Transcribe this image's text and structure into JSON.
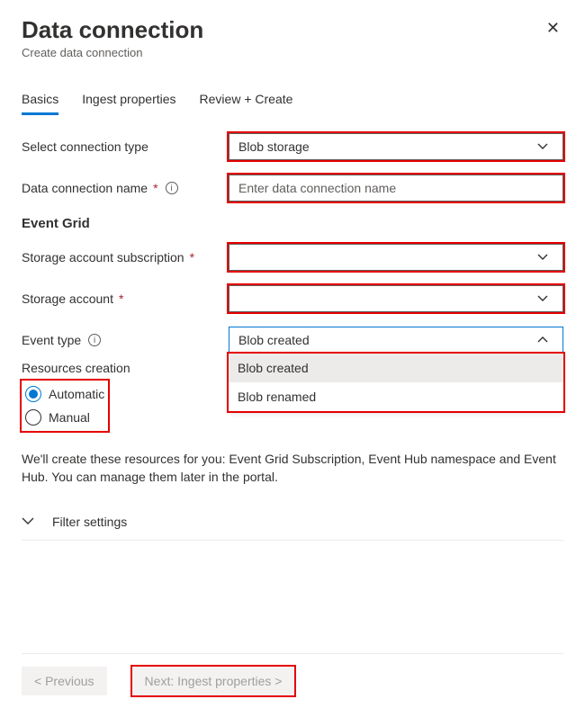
{
  "header": {
    "title": "Data connection",
    "subtitle": "Create data connection"
  },
  "tabs": {
    "basics": "Basics",
    "ingest": "Ingest properties",
    "review": "Review + Create"
  },
  "labels": {
    "connection_type": "Select connection type",
    "connection_name": "Data connection name",
    "event_grid_section": "Event Grid",
    "storage_subscription": "Storage account subscription",
    "storage_account": "Storage account",
    "event_type": "Event type",
    "resources_creation": "Resources creation",
    "filter_settings": "Filter settings"
  },
  "fields": {
    "connection_type_value": "Blob storage",
    "connection_name_placeholder": "Enter data connection name",
    "connection_name_value": "",
    "storage_subscription_value": "",
    "storage_account_value": "",
    "event_type_value": "Blob created",
    "event_type_options": {
      "opt1": "Blob created",
      "opt2": "Blob renamed"
    }
  },
  "radios": {
    "automatic": "Automatic",
    "manual": "Manual"
  },
  "help_text": "We'll create these resources for you: Event Grid Subscription, Event Hub namespace and Event Hub. You can manage them later in the portal.",
  "footer": {
    "previous": "< Previous",
    "next": "Next: Ingest properties >"
  }
}
